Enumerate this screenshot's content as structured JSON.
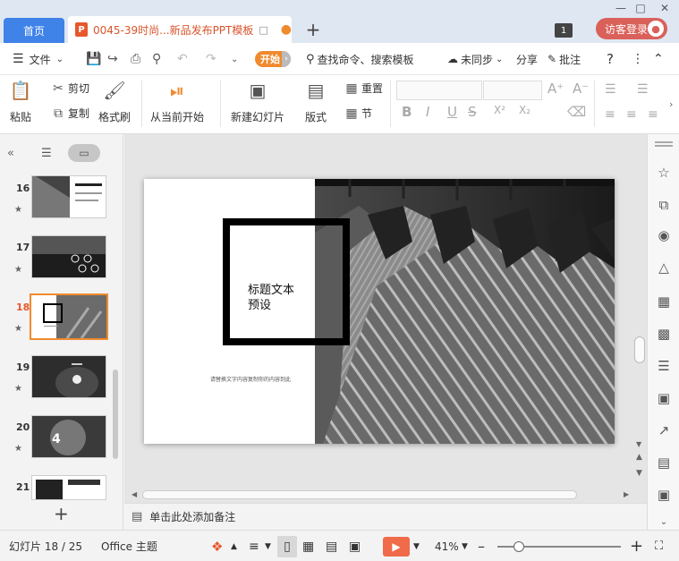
{
  "titlebar": {
    "home_tab": "首页",
    "doc_badge": "P",
    "doc_title": "0045-39时尚...新品发布PPT模板",
    "doc_extra": "□",
    "doc_dot": "●",
    "add_tab": "+",
    "badge_count": "1",
    "login": "访客登录"
  },
  "menubar": {
    "file": "文件",
    "start": "开始",
    "search": "查找命令、搜索模板",
    "sync": "未同步",
    "share": "分享",
    "comment": "批注"
  },
  "ribbon": {
    "paste": "粘贴",
    "cut": "剪切",
    "copy": "复制",
    "format_painter": "格式刷",
    "from_current": "从当前开始",
    "new_slide": "新建幻灯片",
    "layout": "版式",
    "reset": "重置",
    "section": "节",
    "bold": "B",
    "italic": "I",
    "underline": "U",
    "strike": "S",
    "superscript": "X²",
    "subscript": "X₂"
  },
  "thumbnails": [
    {
      "num": "16",
      "active": false
    },
    {
      "num": "17",
      "active": false
    },
    {
      "num": "18",
      "active": true
    },
    {
      "num": "19",
      "active": false
    },
    {
      "num": "20",
      "active": false
    },
    {
      "num": "21",
      "active": false
    }
  ],
  "slide": {
    "title_line1": "标题文本",
    "title_line2": "预设",
    "subtitle": "请替换文字内容复制你的内容到此"
  },
  "notes": {
    "placeholder": "单击此处添加备注"
  },
  "status": {
    "slide_info": "幻灯片 18 / 25",
    "theme": "Office 主题",
    "zoom": "41%"
  },
  "colors": {
    "accent_orange": "#f08a2e",
    "home_tab_blue": "#3f82e8",
    "login_red": "#d9615a",
    "play_red": "#f06b4a"
  }
}
